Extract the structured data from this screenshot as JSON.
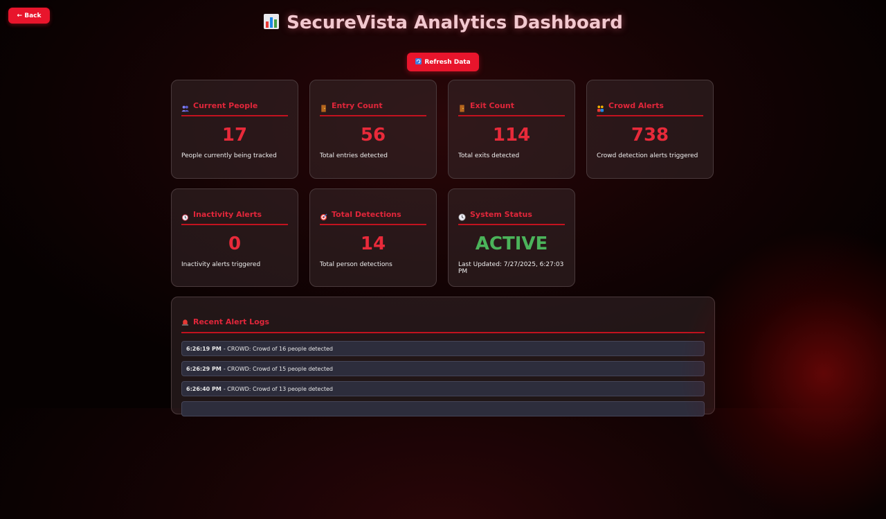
{
  "back_label": "← Back",
  "title": "SecureVista Analytics Dashboard",
  "title_icon": "bar-chart-icon",
  "refresh_label": "Refresh Data",
  "cards": [
    {
      "icon": "people-icon",
      "label": "Current People",
      "value": "17",
      "desc": "People currently being tracked"
    },
    {
      "icon": "door-icon",
      "label": "Entry Count",
      "value": "56",
      "desc": "Total entries detected"
    },
    {
      "icon": "door-icon",
      "label": "Exit Count",
      "value": "114",
      "desc": "Total exits detected"
    },
    {
      "icon": "group-icon",
      "label": "Crowd Alerts",
      "value": "738",
      "desc": "Crowd detection alerts triggered"
    },
    {
      "icon": "alarm-clock-icon",
      "label": "Inactivity Alerts",
      "value": "0",
      "desc": "Inactivity alerts triggered"
    },
    {
      "icon": "target-icon",
      "label": "Total Detections",
      "value": "14",
      "desc": "Total person detections"
    },
    {
      "icon": "clock-icon",
      "label": "System Status",
      "value": "ACTIVE",
      "desc": "Last Updated: 7/27/2025, 6:27:03 PM"
    }
  ],
  "logs_title": "Recent Alert Logs",
  "logs": [
    {
      "time": "6:26:19 PM",
      "text": "- CROWD: Crowd of 16 people detected"
    },
    {
      "time": "6:26:29 PM",
      "text": "- CROWD: Crowd of 15 people detected"
    },
    {
      "time": "6:26:40 PM",
      "text": "- CROWD: Crowd of 13 people detected"
    },
    {
      "time": "",
      "text": ""
    }
  ],
  "colors": {
    "accent": "#e8152c",
    "value": "#e82a3a",
    "active": "#4bb35a"
  }
}
